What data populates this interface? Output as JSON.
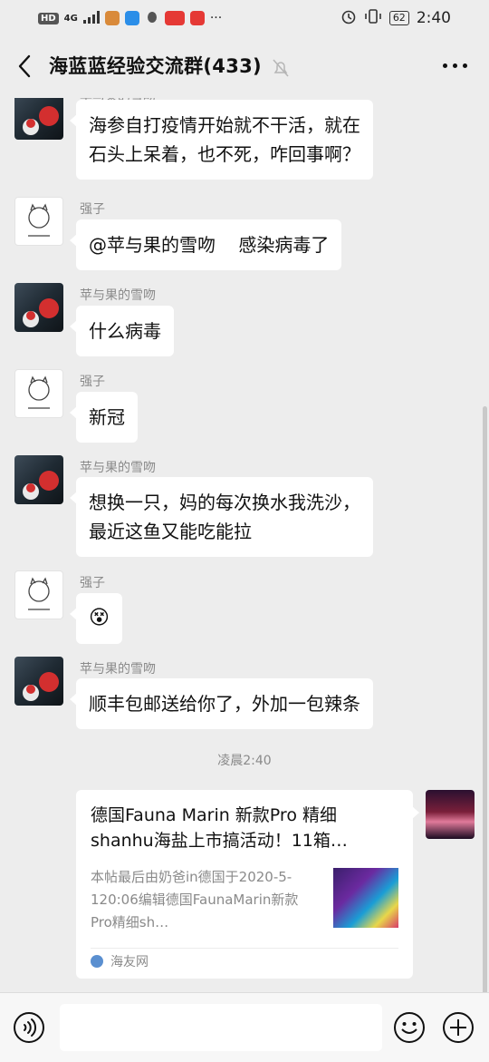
{
  "status_bar": {
    "network": "HD",
    "signal": "4G",
    "battery": "62",
    "time": "2:40"
  },
  "header": {
    "title": "海蓝蓝经验交流群(433)",
    "icons": [
      "back-arrow-icon",
      "mute-bell-icon",
      "more-icon"
    ]
  },
  "messages": [
    {
      "sender": "苹与果的雪吻",
      "text": "海参自打疫情开始就不干活，就在\n石头上呆着，也不死，咋回事啊？"
    },
    {
      "sender": "强子",
      "text": "@苹与果的雪吻    感染病毒了"
    },
    {
      "sender": "苹与果的雪吻",
      "text": "什么病毒"
    },
    {
      "sender": "强子",
      "text": "新冠"
    },
    {
      "sender": "苹与果的雪吻",
      "text": "想换一只，妈的每次换水我洗沙，\n最近这鱼又能吃能拉"
    },
    {
      "sender": "强子",
      "text": "😵"
    },
    {
      "sender": "苹与果的雪吻",
      "text": "顺丰包邮送给你了，外加一包辣条"
    }
  ],
  "timestamp": "凌晨2:40",
  "link_card": {
    "title": "德国Fauna Marin 新款Pro 精细shanhu海盐上市搞活动！11箱…",
    "desc": "本帖最后由奶爸in德国于2020-5-120:06编辑德国FaunaMarin新款Pro精细sh…",
    "source": "海友网"
  },
  "input_bar": {
    "icons": [
      "voice-icon",
      "emoji-icon",
      "plus-icon"
    ]
  }
}
